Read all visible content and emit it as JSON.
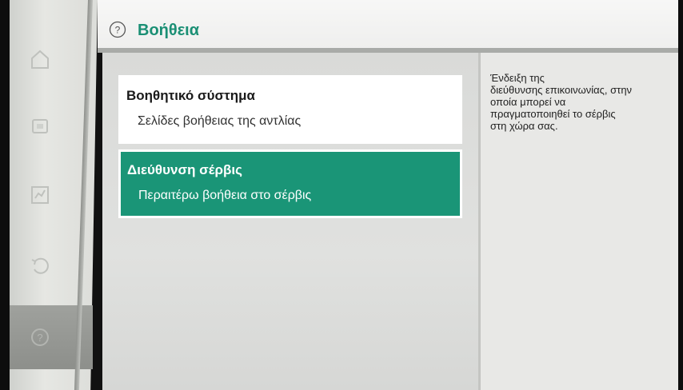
{
  "header": {
    "title": "Βοήθεια",
    "icon": "help-circle-icon",
    "accent_color": "#1a8f74"
  },
  "rail": {
    "items": [
      {
        "icon": "home-icon"
      },
      {
        "icon": "device-icon"
      },
      {
        "icon": "settings-chart-icon"
      },
      {
        "icon": "undo-icon"
      },
      {
        "icon": "help-icon",
        "active": true
      }
    ]
  },
  "menu": {
    "items": [
      {
        "title": "Βοηθητικό σύστημα",
        "subtitle": "Σελίδες βοήθειας της αντλίας",
        "selected": false
      },
      {
        "title": "Διεύθυνση σέρβις",
        "subtitle": "Περαιτέρω βοήθεια στο σέρβις",
        "selected": true
      }
    ],
    "selected_color": "#1a9577"
  },
  "info_panel": {
    "text": "Ένδειξη της\nδιεύθυνσης επικοινωνίας, στην\nοποία μπορεί να\nπραγματοποιηθεί το σέρβις\nστη χώρα σας."
  }
}
